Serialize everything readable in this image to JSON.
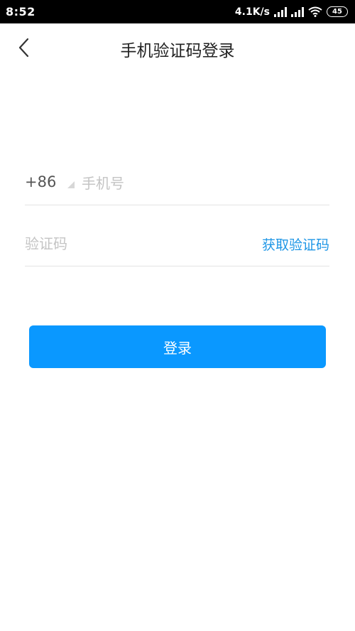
{
  "status_bar": {
    "time": "8:52",
    "net_speed": "4.1K/s",
    "battery_level": "45",
    "icons": [
      "signal-icon",
      "signal-icon",
      "wifi-icon",
      "battery-icon"
    ]
  },
  "header": {
    "title": "手机验证码登录",
    "back_icon": "chevron-left-icon"
  },
  "form": {
    "country_code": "+86",
    "phone_placeholder": "手机号",
    "code_placeholder": "验证码",
    "get_code_label": "获取验证码"
  },
  "login_button": {
    "label": "登录"
  },
  "colors": {
    "accent": "#0a98ff",
    "link": "#1e96e6",
    "title": "#222222",
    "placeholder": "#c4c4c4",
    "divider": "#e3e3e3"
  }
}
